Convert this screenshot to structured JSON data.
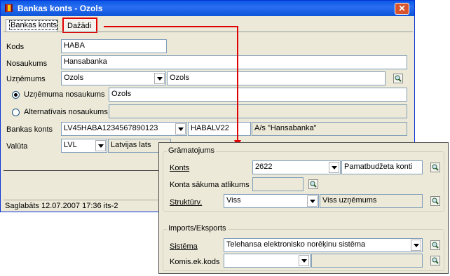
{
  "window": {
    "title": "Bankas konts - Ozols",
    "close_symbol": "✕"
  },
  "tabs": [
    {
      "label": "Bankas konts"
    },
    {
      "label": "Dažādi"
    }
  ],
  "form": {
    "kods": {
      "label": "Kods",
      "value": "HABA"
    },
    "nosaukums": {
      "label": "Nosaukums",
      "value": "Hansabanka"
    },
    "uznemums": {
      "label": "Uzņēmums",
      "code": "Ozols",
      "name": "Ozols"
    },
    "radio1": {
      "label": "Uzņēmuma nosaukums",
      "value": "Ozols",
      "checked": true
    },
    "radio2": {
      "label": "Alternatīvais nosaukums",
      "value": "",
      "checked": false
    },
    "bankas_konts": {
      "label": "Bankas konts",
      "account": "LV45HABA1234567890123",
      "swift": "HABALV22",
      "bank": "A/s \"Hansabanka\""
    },
    "valuta": {
      "label": "Valūta",
      "code": "LVL",
      "name": "Latvijas lats"
    }
  },
  "status": "Saglabāts 12.07.2007 17:36 its-2",
  "popup": {
    "gramatojums": {
      "title": "Grāmatojums",
      "konts": {
        "label": "Konts",
        "value": "2622",
        "name": "Pamatbudžeta konti"
      },
      "atlikums": {
        "label": "Konta sākuma atlikums",
        "value": ""
      },
      "strukturv": {
        "label": "Struktūrv.",
        "value": "Viss",
        "name": "Viss uzņēmums"
      }
    },
    "imports": {
      "title": "Imports/Eksports",
      "sistema": {
        "label": "Sistēma",
        "value": "Telehansa elektronisko norēķinu sistēma"
      },
      "komis": {
        "label": "Komis.ek.kods",
        "value": ""
      }
    }
  },
  "colors": {
    "highlight": "#e00000",
    "titlebar": "#0a58e4"
  }
}
